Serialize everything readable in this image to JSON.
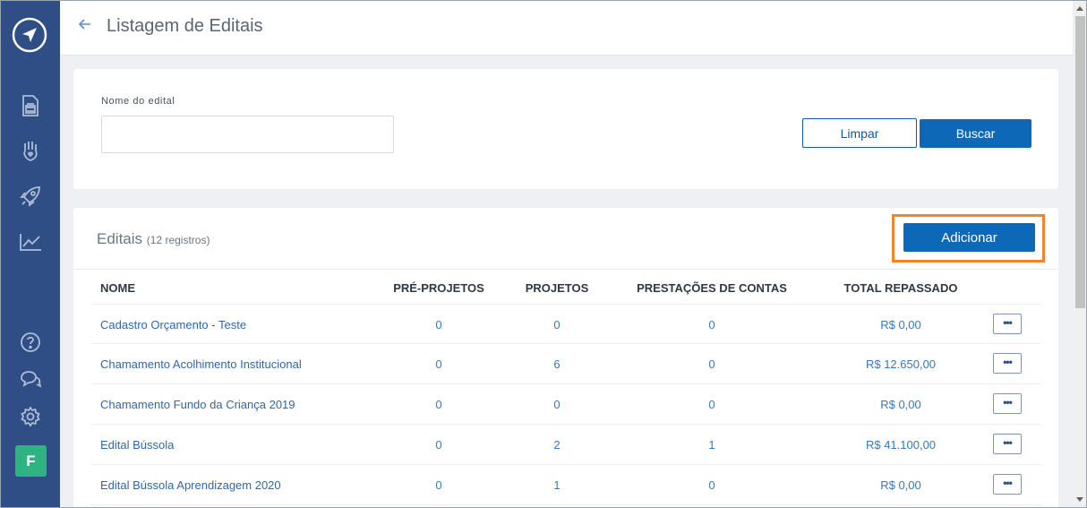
{
  "header": {
    "title": "Listagem de Editais"
  },
  "sidebar": {
    "items": [
      {
        "icon": "document-icon"
      },
      {
        "icon": "hand-heart-icon"
      },
      {
        "icon": "rocket-icon"
      },
      {
        "icon": "chart-icon"
      },
      {
        "icon": "help-icon"
      },
      {
        "icon": "chat-icon"
      },
      {
        "icon": "gear-icon"
      }
    ],
    "avatar": "F"
  },
  "filter": {
    "label": "Nome do edital",
    "value": "",
    "clear_label": "Limpar",
    "search_label": "Buscar"
  },
  "list": {
    "title": "Editais",
    "count": "(12 registros)",
    "add_label": "Adicionar",
    "columns": [
      "NOME",
      "PRÉ-PROJETOS",
      "PROJETOS",
      "PRESTAÇÕES DE CONTAS",
      "TOTAL REPASSADO"
    ],
    "rows": [
      {
        "name": "Cadastro Orçamento - Teste",
        "pre": "0",
        "proj": "0",
        "prest": "0",
        "total": "R$ 0,00"
      },
      {
        "name": "Chamamento Acolhimento Institucional",
        "pre": "0",
        "proj": "6",
        "prest": "0",
        "total": "R$ 12.650,00"
      },
      {
        "name": "Chamamento Fundo da Criança 2019",
        "pre": "0",
        "proj": "0",
        "prest": "0",
        "total": "R$ 0,00"
      },
      {
        "name": "Edital Bússola",
        "pre": "0",
        "proj": "2",
        "prest": "1",
        "total": "R$ 41.100,00"
      },
      {
        "name": "Edital Bússola Aprendizagem 2020",
        "pre": "0",
        "proj": "1",
        "prest": "0",
        "total": "R$ 0,00"
      }
    ],
    "more_label": "•••"
  },
  "colors": {
    "sidebar": "#2f4e86",
    "primary": "#0d68b8",
    "highlight": "#f5822c",
    "avatar": "#2fb380"
  }
}
